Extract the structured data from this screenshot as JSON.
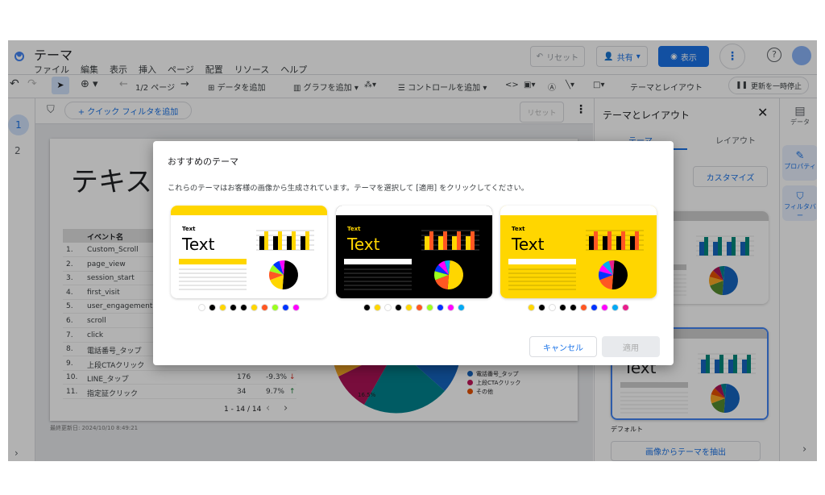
{
  "app": {
    "title": "テーマ",
    "menu": [
      "ファイル",
      "編集",
      "表示",
      "挿入",
      "ページ",
      "配置",
      "リソース",
      "ヘルプ"
    ],
    "reset": "リセット",
    "share": "共有",
    "view": "表示",
    "help_icon": "help-circle-icon"
  },
  "toolbar": {
    "page": "1/2 ページ",
    "add_data": "データを追加",
    "add_chart": "グラフを追加",
    "add_control": "コントロールを追加",
    "theme_layout": "テーマとレイアウト",
    "pause": "更新を一時停止"
  },
  "filterbar": {
    "quick_filter": "+ クイック フィルタを追加",
    "reset": "リセット"
  },
  "pages": [
    "1",
    "2"
  ],
  "report": {
    "heading": "テキス",
    "table_header": "イベント名",
    "rows": [
      {
        "n": "1.",
        "name": "Custom_Scroll"
      },
      {
        "n": "2.",
        "name": "page_view"
      },
      {
        "n": "3.",
        "name": "session_start"
      },
      {
        "n": "4.",
        "name": "first_visit"
      },
      {
        "n": "5.",
        "name": "user_engagement"
      },
      {
        "n": "6.",
        "name": "scroll"
      },
      {
        "n": "7.",
        "name": "click"
      },
      {
        "n": "8.",
        "name": "電話番号_タップ"
      },
      {
        "n": "9.",
        "name": "上段CTAクリック"
      },
      {
        "n": "10.",
        "name": "LINE_タップ",
        "value": "176",
        "change": "-9.3%",
        "dir": "down"
      },
      {
        "n": "11.",
        "name": "指定証クリック",
        "value": "34",
        "change": "9.7%",
        "dir": "up"
      }
    ],
    "pagination": "1 - 14 / 14",
    "pie_label": "16.5%",
    "legend": [
      {
        "label": "電話番号_タップ",
        "color": "#1565c0"
      },
      {
        "label": "上段CTAクリック",
        "color": "#c2185b"
      },
      {
        "label": "その他",
        "color": "#e65100"
      }
    ],
    "last_updated": "最終更新日: 2024/10/10 8:49:21"
  },
  "panel": {
    "title": "テーマとレイアウト",
    "tabs": [
      "テーマ",
      "レイアウト"
    ],
    "customize": "カスタマイズ",
    "default_label": "デフォルト",
    "extract": "画像からテーマを抽出"
  },
  "rail": {
    "data": "データ",
    "properties": "プロパティ",
    "filterbar": "フィルタバー"
  },
  "dialog": {
    "title": "おすすめのテーマ",
    "description": "これらのテーマはお客様の画像から生成されています。テーマを選択して [適用] をクリックしてください。",
    "cancel": "キャンセル",
    "apply": "適用",
    "sample_small": "Text",
    "sample_big": "Text",
    "themes": [
      {
        "strip": "#FFD600",
        "bg": "#ffffff",
        "text": "#000000",
        "bar1": "#000000",
        "bar2": "#FFD600",
        "lead": "#FFD600",
        "lines": "#bdbdbd",
        "pie": [
          "#000000",
          "#FFD600",
          "#FF5722",
          "#9CFF1E",
          "#0033FF",
          "#FF00FF"
        ],
        "palette": [
          "#ffffff",
          "#000000",
          "#FFD600",
          "#000000",
          "#000000",
          "#FFD600",
          "#FF5722",
          "#9CFF1E",
          "#0033FF",
          "#FF00FF"
        ]
      },
      {
        "strip": "#ffffff",
        "bg": "#000000",
        "text": "#FFD600",
        "bar1": "#FFD600",
        "bar2": "#FF5722",
        "lead": "#ffffff",
        "lines": "#555555",
        "pie": [
          "#FFD600",
          "#FF5722",
          "#9CFF1E",
          "#0033FF",
          "#FF00FF",
          "#03A9F4"
        ],
        "palette": [
          "#000000",
          "#FFD600",
          "#ffffff",
          "#000000",
          "#FFD600",
          "#FF5722",
          "#9CFF1E",
          "#0033FF",
          "#FF00FF",
          "#03A9F4"
        ]
      },
      {
        "strip": "#ffffff",
        "bg": "#FFD600",
        "text": "#000000",
        "bar1": "#000000",
        "bar2": "#FF5722",
        "lead": "#ffffff",
        "lines": "#b59a00",
        "pie": [
          "#000000",
          "#FF5722",
          "#0033FF",
          "#FF00FF",
          "#03A9F4",
          "#E91E8C"
        ],
        "palette": [
          "#FFD600",
          "#000000",
          "#ffffff",
          "#000000",
          "#000000",
          "#FF5722",
          "#0033FF",
          "#FF00FF",
          "#03A9F4",
          "#E91E8C"
        ]
      }
    ]
  },
  "default_theme": {
    "strip": "#cfcfcf",
    "bg": "#ffffff",
    "text": "#202124",
    "bar1": "#1565c0",
    "bar2": "#00897b",
    "lead": "#cfcfcf",
    "lines": "#dddddd",
    "pie": [
      "#1565c0",
      "#558b2f",
      "#f9a825",
      "#e65100",
      "#ad1457",
      "#00838f"
    ]
  }
}
